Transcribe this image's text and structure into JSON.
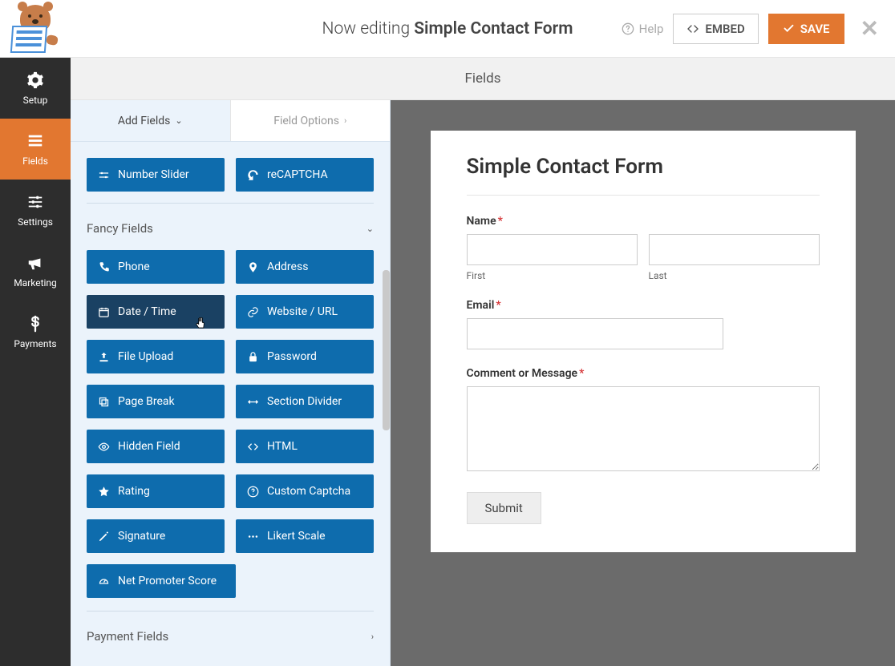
{
  "header": {
    "editing_prefix": "Now editing ",
    "form_name": "Simple Contact Form",
    "help": "Help",
    "embed": "EMBED",
    "save": "SAVE"
  },
  "nav": {
    "setup": "Setup",
    "fields": "Fields",
    "settings": "Settings",
    "marketing": "Marketing",
    "payments": "Payments"
  },
  "section_title": "Fields",
  "tabs": {
    "add": "Add Fields",
    "options": "Field Options"
  },
  "standard_row": {
    "number_slider": "Number Slider",
    "recaptcha": "reCAPTCHA"
  },
  "fancy": {
    "heading": "Fancy Fields",
    "phone": "Phone",
    "address": "Address",
    "datetime": "Date / Time",
    "website": "Website / URL",
    "upload": "File Upload",
    "password": "Password",
    "pagebreak": "Page Break",
    "divider": "Section Divider",
    "hidden": "Hidden Field",
    "html": "HTML",
    "rating": "Rating",
    "captcha": "Custom Captcha",
    "signature": "Signature",
    "likert": "Likert Scale",
    "nps": "Net Promoter Score"
  },
  "payment": {
    "heading": "Payment Fields"
  },
  "form": {
    "title": "Simple Contact Form",
    "name_label": "Name",
    "first": "First",
    "last": "Last",
    "email_label": "Email",
    "comment_label": "Comment or Message",
    "submit": "Submit"
  }
}
